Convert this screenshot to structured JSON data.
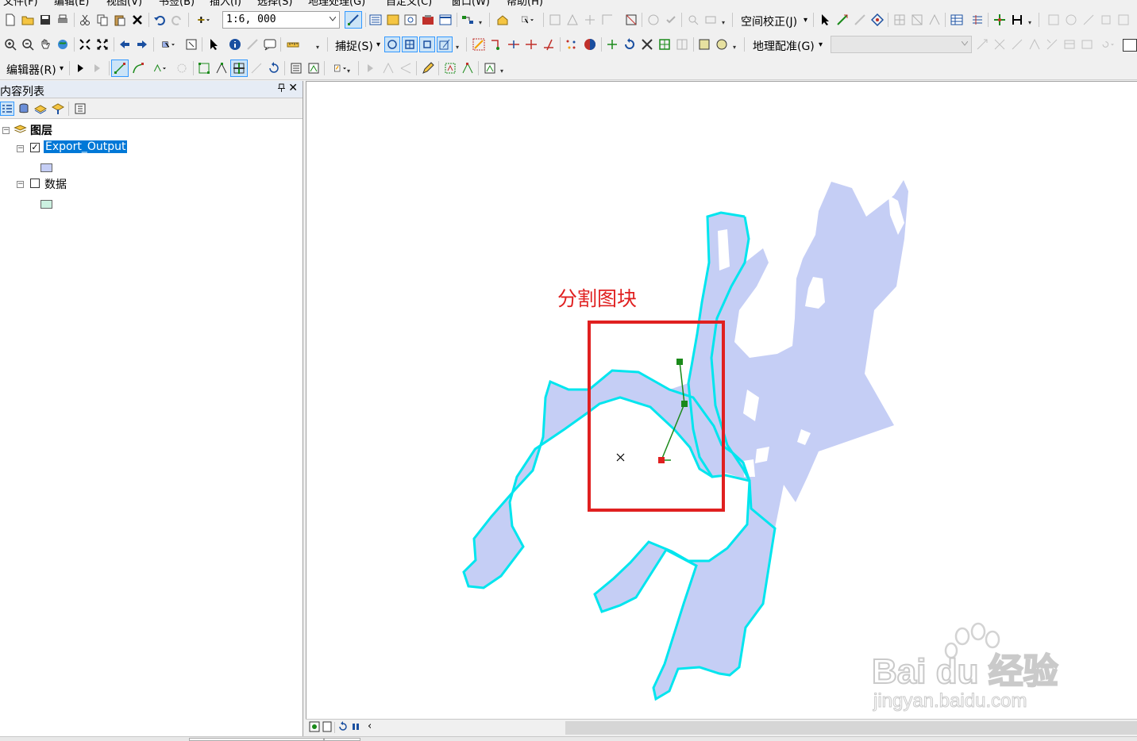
{
  "menubar": {
    "items": [
      "文件(F)",
      "编辑(E)",
      "视图(V)",
      "书签(B)",
      "插入(I)",
      "选择(S)",
      "地理处理(G)",
      "自定义(C)",
      "窗口(W)",
      "帮助(H)"
    ]
  },
  "toolbar1": {
    "scale_value": "1:6, 000",
    "spatial_adjust_label": "空间校正(J)"
  },
  "toolbar2": {
    "snapping_label": "捕捉(S)",
    "georef_label": "地理配准(G)"
  },
  "toolbar3": {
    "editor_label": "编辑器(R)"
  },
  "toc": {
    "title": "内容列表",
    "pin_glyph": "ᵖ",
    "close_glyph": "✕",
    "root_label": "图层",
    "layers": [
      {
        "name": "Export_Output",
        "checked": true,
        "selected": true,
        "swatch_color": "#c5cef5"
      },
      {
        "name": "数据",
        "checked": false,
        "selected": false,
        "swatch_color": "#ccf0e0"
      }
    ]
  },
  "map": {
    "annotation": "分割图块",
    "annotation_color": "#e02020",
    "polygon_fill": "#c5cef5",
    "outline_color": "#00e5ee",
    "rect_color": "#e02020",
    "sketch_color": "#1a8a1a"
  },
  "watermark": {
    "brand": "Bai du 经验",
    "url": "jingyan.baidu.com"
  },
  "colors": {
    "selection": "#0078d7",
    "toolbar_bg": "#f0f0f0"
  }
}
